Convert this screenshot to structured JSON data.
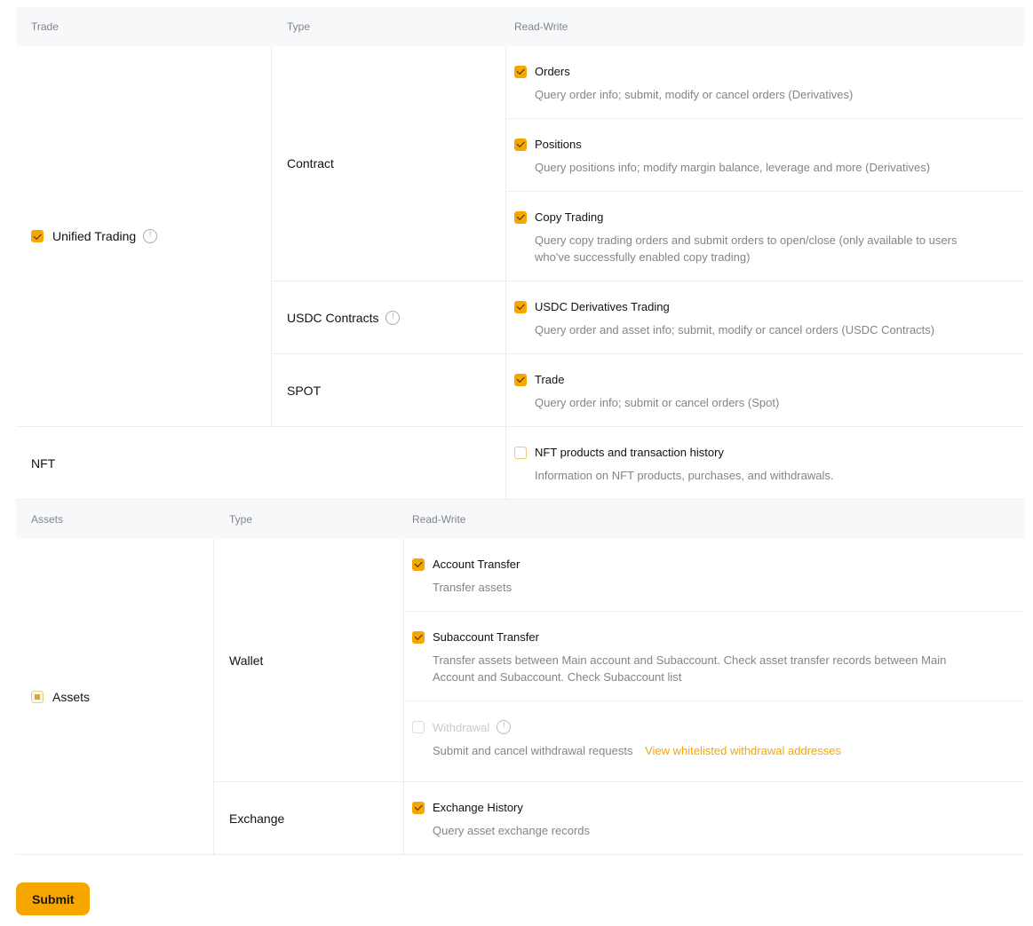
{
  "colors": {
    "accent": "#f7a600",
    "header_bg": "#f7f8f9",
    "label": "#121214",
    "muted": "#81858c",
    "disabled": "#c8cad0"
  },
  "icons": {
    "info_glyph": "!"
  },
  "submit_label": "Submit",
  "tables": [
    {
      "headers": [
        "Trade",
        "Type",
        "Read-Write"
      ],
      "sections": [
        {
          "label": "Unified Trading",
          "checkbox": "checked",
          "has_info": true,
          "type_rows": [
            {
              "label": "Contract",
              "permissions": [
                {
                  "label": "Orders",
                  "checkbox": "checked",
                  "desc": "Query order info; submit, modify or cancel orders (Derivatives)"
                },
                {
                  "label": "Positions",
                  "checkbox": "checked",
                  "desc": "Query positions info; modify margin balance, leverage and more (Derivatives)"
                },
                {
                  "label": "Copy Trading",
                  "checkbox": "checked",
                  "desc": "Query copy trading orders and submit orders to open/close (only available to users who've successfully enabled copy trading)"
                }
              ]
            },
            {
              "label": "USDC Contracts",
              "has_info": true,
              "permissions": [
                {
                  "label": "USDC Derivatives Trading",
                  "checkbox": "checked",
                  "desc": "Query order and asset info; submit, modify or cancel orders (USDC Contracts)"
                }
              ]
            },
            {
              "label": "SPOT",
              "permissions": [
                {
                  "label": "Trade",
                  "checkbox": "checked",
                  "desc": "Query order info; submit or cancel orders (Spot)"
                }
              ]
            }
          ]
        },
        {
          "label": "NFT",
          "checkbox": "none",
          "merge_type": true,
          "type_rows": [
            {
              "label": "",
              "permissions": [
                {
                  "label": "NFT products and transaction history",
                  "checkbox": "unchecked",
                  "desc": "Information on NFT products, purchases, and withdrawals."
                }
              ]
            }
          ]
        }
      ]
    },
    {
      "headers": [
        "Assets",
        "Type",
        "Read-Write"
      ],
      "sections": [
        {
          "label": "Assets",
          "checkbox": "indeterminate",
          "type_rows": [
            {
              "label": "Wallet",
              "permissions": [
                {
                  "label": "Account Transfer",
                  "checkbox": "checked",
                  "desc": "Transfer assets"
                },
                {
                  "label": "Subaccount Transfer",
                  "checkbox": "checked",
                  "desc": "Transfer assets between Main account and Subaccount. Check asset transfer records between Main Account and Subaccount. Check Subaccount list"
                },
                {
                  "label": "Withdrawal",
                  "checkbox": "disabled",
                  "has_info": true,
                  "desc": "Submit and cancel withdrawal requests",
                  "link": "View whitelisted withdrawal addresses"
                }
              ]
            },
            {
              "label": "Exchange",
              "permissions": [
                {
                  "label": "Exchange History",
                  "checkbox": "checked",
                  "desc": "Query asset exchange records"
                }
              ]
            }
          ]
        }
      ]
    }
  ]
}
